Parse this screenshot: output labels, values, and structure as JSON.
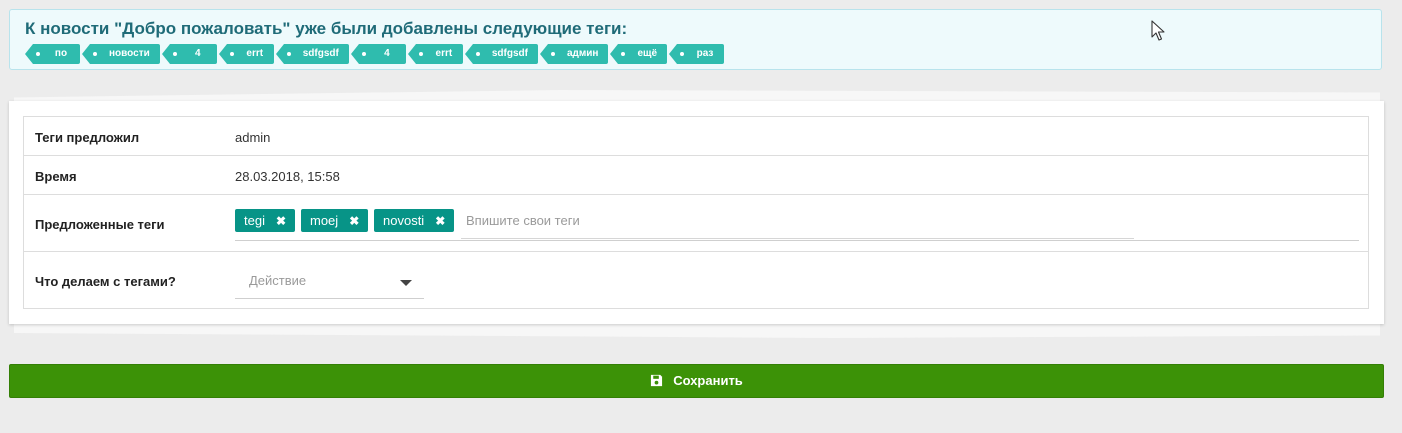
{
  "alert": {
    "title": "К новости \"Добро пожаловать\" уже были добавлены следующие теги:",
    "tags": [
      "по",
      "новости",
      "4",
      "errt",
      "sdfgsdf",
      "4",
      "errt",
      "sdfgsdf",
      "админ",
      "ещё",
      "раз"
    ]
  },
  "form": {
    "rows": [
      {
        "label": "Теги предложил",
        "value": "admin"
      },
      {
        "label": "Время",
        "value": "28.03.2018, 15:58"
      },
      {
        "label": "Предложенные теги"
      },
      {
        "label": "Что делаем с тегами?"
      }
    ],
    "suggested_tags": [
      "tegi",
      "moej",
      "novosti"
    ],
    "tag_input_placeholder": "Впишите свои теги",
    "action_select": {
      "placeholder": "Действие"
    }
  },
  "save_button": {
    "label": "Сохранить"
  },
  "colors": {
    "alert_bg": "#eefafc",
    "alert_title": "#1f6b78",
    "tag_teal": "#2fbcae",
    "chip_teal": "#079487",
    "save_green": "#3c9207",
    "page_bg": "#ececec"
  },
  "icons": {
    "save": "floppy-disk-icon",
    "chip_remove": "close-icon",
    "select_caret": "caret-down-icon",
    "cursor": "mouse-pointer-icon"
  }
}
